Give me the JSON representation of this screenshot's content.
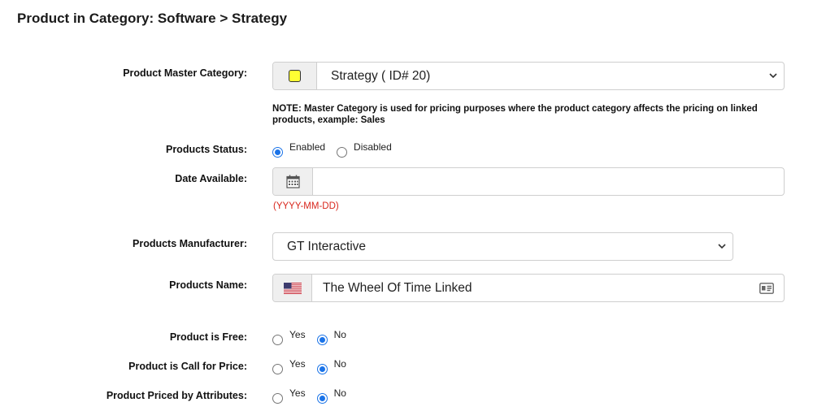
{
  "page": {
    "title": "Product in Category: Software > Strategy"
  },
  "master_category": {
    "label": "Product Master Category:",
    "value": "Strategy ( ID# 20)",
    "note": "NOTE: Master Category is used for pricing purposes where the product category affects the pricing on linked products, example: Sales",
    "indicator_color": "#ffff33"
  },
  "status": {
    "label": "Products Status:",
    "options": [
      "Enabled",
      "Disabled"
    ],
    "selected": "Enabled"
  },
  "date_available": {
    "label": "Date Available:",
    "value": "",
    "format_hint": "(YYYY-MM-DD)"
  },
  "manufacturer": {
    "label": "Products Manufacturer:",
    "value": "GT Interactive"
  },
  "name": {
    "label": "Products Name:",
    "value": "The Wheel Of Time Linked"
  },
  "free": {
    "label": "Product is Free:",
    "yes": "Yes",
    "no": "No",
    "selected": "No"
  },
  "call_for_price": {
    "label": "Product is Call for Price:",
    "yes": "Yes",
    "no": "No",
    "selected": "No"
  },
  "priced_by_attributes": {
    "label": "Product Priced by Attributes:",
    "yes": "Yes",
    "no": "No",
    "selected": "No"
  },
  "colors": {
    "accent": "#1a73e8",
    "hint": "#d8261c"
  }
}
